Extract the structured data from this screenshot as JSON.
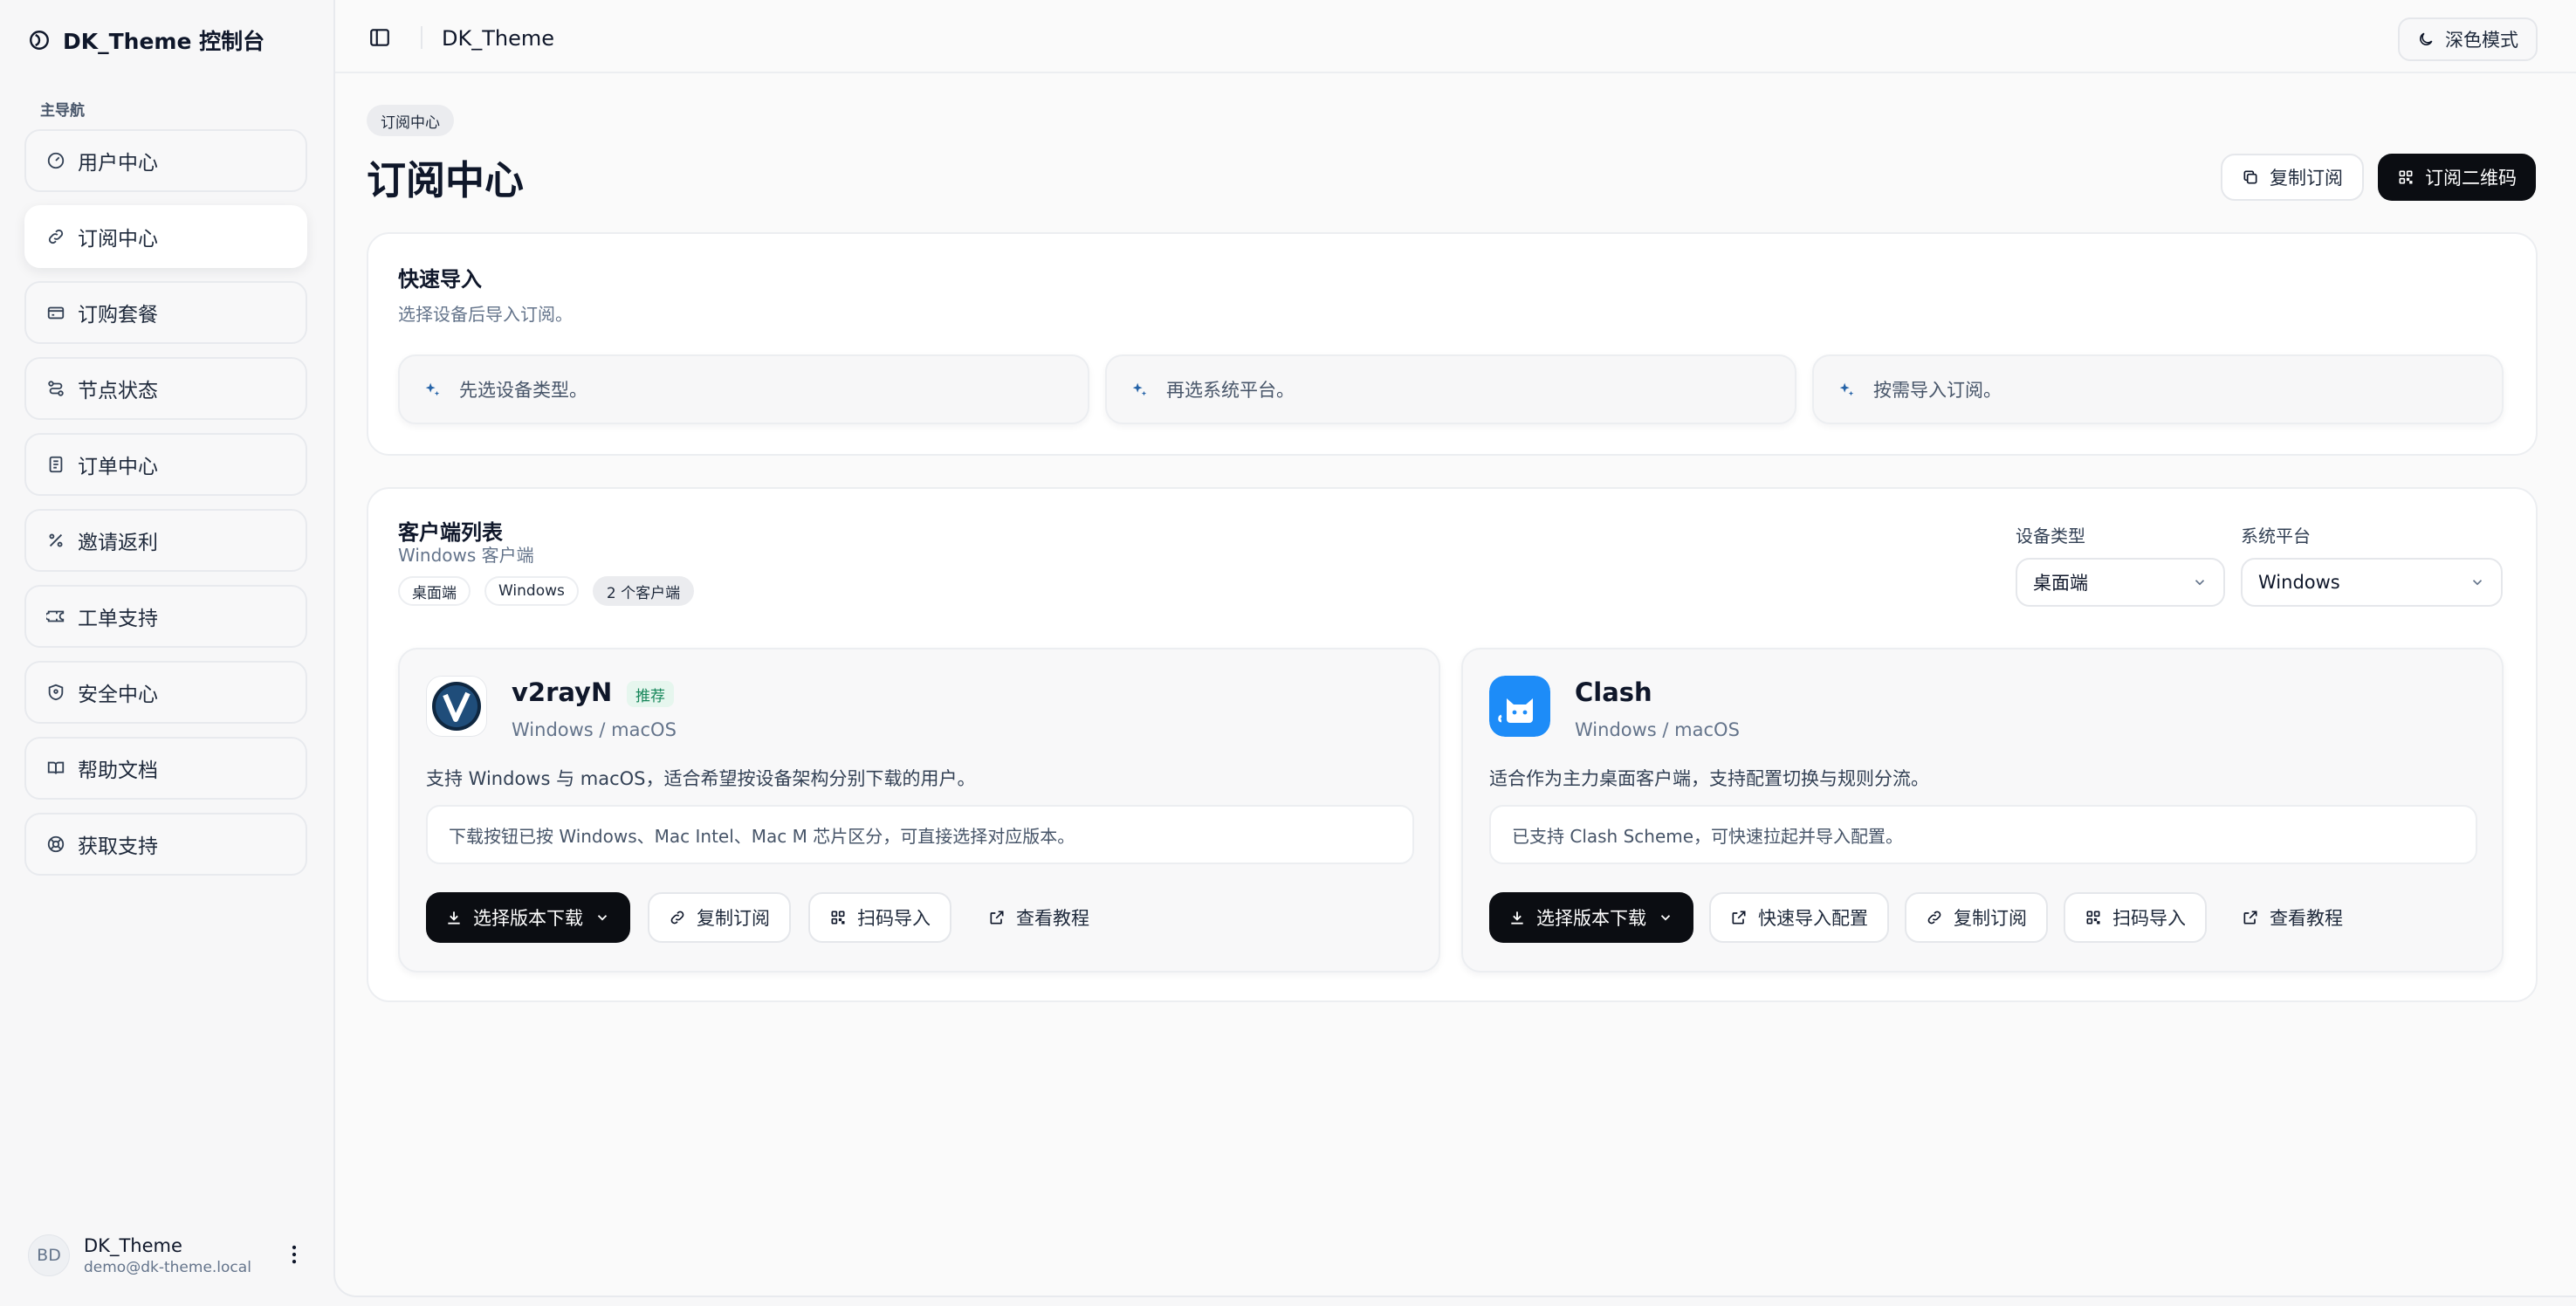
{
  "sidebar": {
    "brand": "DK_Theme 控制台",
    "nav_heading": "主导航",
    "items": [
      {
        "label": "用户中心",
        "icon": "gauge-icon"
      },
      {
        "label": "订阅中心",
        "icon": "link-icon"
      },
      {
        "label": "订购套餐",
        "icon": "credit-card-icon"
      },
      {
        "label": "节点状态",
        "icon": "route-icon"
      },
      {
        "label": "订单中心",
        "icon": "receipt-icon"
      },
      {
        "label": "邀请返利",
        "icon": "percent-icon"
      },
      {
        "label": "工单支持",
        "icon": "ticket-icon"
      },
      {
        "label": "安全中心",
        "icon": "shield-icon"
      },
      {
        "label": "帮助文档",
        "icon": "book-icon"
      },
      {
        "label": "获取支持",
        "icon": "lifebuoy-icon"
      }
    ],
    "active_index": 1,
    "user": {
      "initials": "BD",
      "name": "DK_Theme",
      "email": "demo@dk-theme.local"
    }
  },
  "topbar": {
    "title": "DK_Theme",
    "theme_toggle_label": "深色模式"
  },
  "page": {
    "breadcrumb": "订阅中心",
    "title": "订阅中心",
    "copy_subscription_label": "复制订阅",
    "qr_code_label": "订阅二维码"
  },
  "quick_import": {
    "title": "快速导入",
    "subtitle": "选择设备后导入订阅。",
    "steps": [
      "先选设备类型。",
      "再选系统平台。",
      "按需导入订阅。"
    ]
  },
  "client_list": {
    "title": "客户端列表",
    "subtitle": "Windows 客户端",
    "tags": [
      "桌面端",
      "Windows",
      "2 个客户端"
    ],
    "device_filter": {
      "label": "设备类型",
      "value": "桌面端"
    },
    "platform_filter": {
      "label": "系统平台",
      "value": "Windows"
    },
    "clients": [
      {
        "name": "v2rayN",
        "badge": "推荐",
        "platform": "Windows / macOS",
        "description": "支持 Windows 与 macOS，适合希望按设备架构分别下载的用户。",
        "note": "下载按钮已按 Windows、Mac Intel、Mac M 芯片区分，可直接选择对应版本。",
        "download_label": "选择版本下载",
        "copy_label": "复制订阅",
        "scan_label": "扫码导入",
        "tutorial_label": "查看教程"
      },
      {
        "name": "Clash",
        "platform": "Windows / macOS",
        "description": "适合作为主力桌面客户端，支持配置切换与规则分流。",
        "note": "已支持 Clash Scheme，可快速拉起并导入配置。",
        "download_label": "选择版本下载",
        "quick_import_label": "快速导入配置",
        "copy_label": "复制订阅",
        "scan_label": "扫码导入",
        "tutorial_label": "查看教程"
      }
    ]
  },
  "colors": {
    "accent_dark": "#0b0d12",
    "badge_green": "#16865a",
    "sparkle_blue": "#2563a8",
    "clash_blue": "#1d8cf8"
  }
}
